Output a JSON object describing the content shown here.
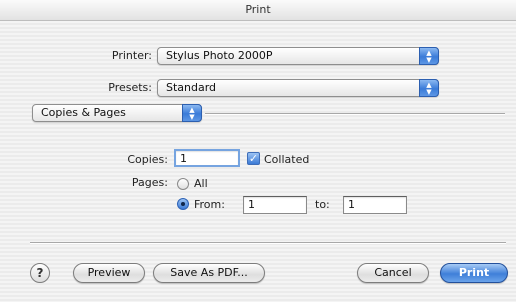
{
  "window": {
    "title": "Print"
  },
  "printer": {
    "label": "Printer:",
    "value": "Stylus Photo 2000P"
  },
  "presets": {
    "label": "Presets:",
    "value": "Standard"
  },
  "panel_menu": {
    "value": "Copies & Pages"
  },
  "copies": {
    "label": "Copies:",
    "value": "1",
    "collated_label": "Collated",
    "collated_checked": true
  },
  "pages": {
    "label": "Pages:",
    "all_label": "All",
    "from_label": "From:",
    "from_value": "1",
    "to_label": "to:",
    "to_value": "1",
    "selected": "from"
  },
  "buttons": {
    "help": "?",
    "preview": "Preview",
    "save_pdf": "Save As PDF...",
    "cancel": "Cancel",
    "print": "Print"
  }
}
